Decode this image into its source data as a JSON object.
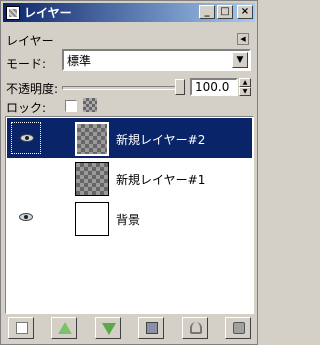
{
  "window": {
    "title": "レイヤー",
    "controls": [
      "_",
      "□",
      "×"
    ]
  },
  "panel": {
    "label": "レイヤー",
    "menu_glyph": "◀"
  },
  "mode": {
    "label": "モード:",
    "value": "標準",
    "arrow": "▼"
  },
  "opacity": {
    "label": "不透明度:",
    "value": "100.0",
    "fraction": 1.0,
    "up": "▲",
    "down": "▼"
  },
  "lock": {
    "label": "ロック:",
    "checked": false
  },
  "layers": [
    {
      "name": "新規レイヤー#2",
      "visible": true,
      "selected": true,
      "thumbnail": "checker"
    },
    {
      "name": "新規レイヤー#1",
      "visible": false,
      "selected": false,
      "thumbnail": "checker"
    },
    {
      "name": "背景",
      "visible": true,
      "selected": false,
      "thumbnail": "white"
    }
  ],
  "bottom_buttons": [
    {
      "name": "new-layer",
      "icon": "new-page-icon"
    },
    {
      "name": "raise-layer",
      "icon": "arrow-up-icon"
    },
    {
      "name": "lower-layer",
      "icon": "arrow-down-icon"
    },
    {
      "name": "duplicate-layer",
      "icon": "duplicate-icon"
    },
    {
      "name": "anchor-layer",
      "icon": "anchor-icon"
    },
    {
      "name": "delete-layer",
      "icon": "trash-icon"
    }
  ],
  "colors": {
    "selection": "#0a246a",
    "title_start": "#0a246a",
    "title_end": "#a6caf0"
  }
}
